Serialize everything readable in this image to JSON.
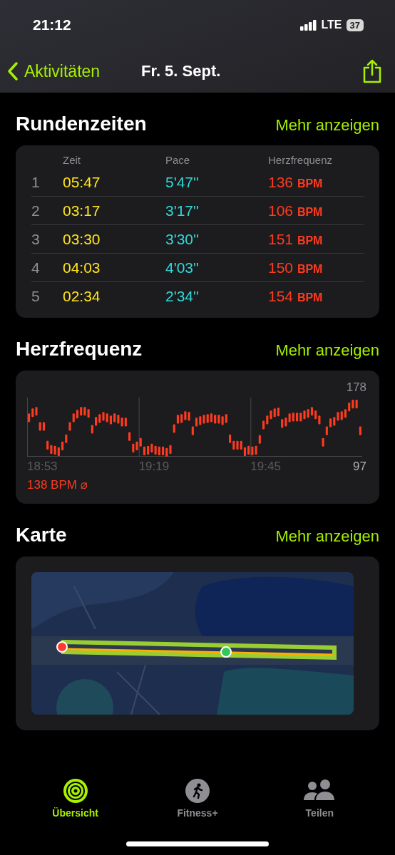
{
  "status_bar": {
    "time": "21:12",
    "network": "LTE",
    "battery": "37"
  },
  "nav": {
    "back": "Aktivitäten",
    "title": "Fr. 5. Sept."
  },
  "laps": {
    "title": "Rundenzeiten",
    "more": "Mehr anzeigen",
    "columns": [
      "Zeit",
      "Pace",
      "Herzfrequenz"
    ],
    "rows": [
      {
        "index": "1",
        "time": "05:47",
        "pace": "5'47''",
        "hr": "136",
        "unit": "BPM"
      },
      {
        "index": "2",
        "time": "03:17",
        "pace": "3'17''",
        "hr": "106",
        "unit": "BPM"
      },
      {
        "index": "3",
        "time": "03:30",
        "pace": "3'30''",
        "hr": "151",
        "unit": "BPM"
      },
      {
        "index": "4",
        "time": "04:03",
        "pace": "4'03''",
        "hr": "150",
        "unit": "BPM"
      },
      {
        "index": "5",
        "time": "02:34",
        "pace": "2'34''",
        "hr": "154",
        "unit": "BPM"
      }
    ]
  },
  "heart_rate": {
    "title": "Herzfrequenz",
    "more": "Mehr anzeigen",
    "summary": "138 BPM ⌀",
    "max_label": "178",
    "min_label": "97",
    "time_labels": [
      "18:53",
      "19:19",
      "19:45"
    ]
  },
  "map": {
    "title": "Karte",
    "more": "Mehr anzeigen",
    "kind": "picture"
  },
  "tabs": [
    {
      "label": "Übersicht",
      "kind": "rings",
      "selected": true
    },
    {
      "label": "Fitness+",
      "kind": "runner",
      "selected": false
    },
    {
      "label": "Teilen",
      "kind": "people",
      "selected": false
    }
  ]
}
